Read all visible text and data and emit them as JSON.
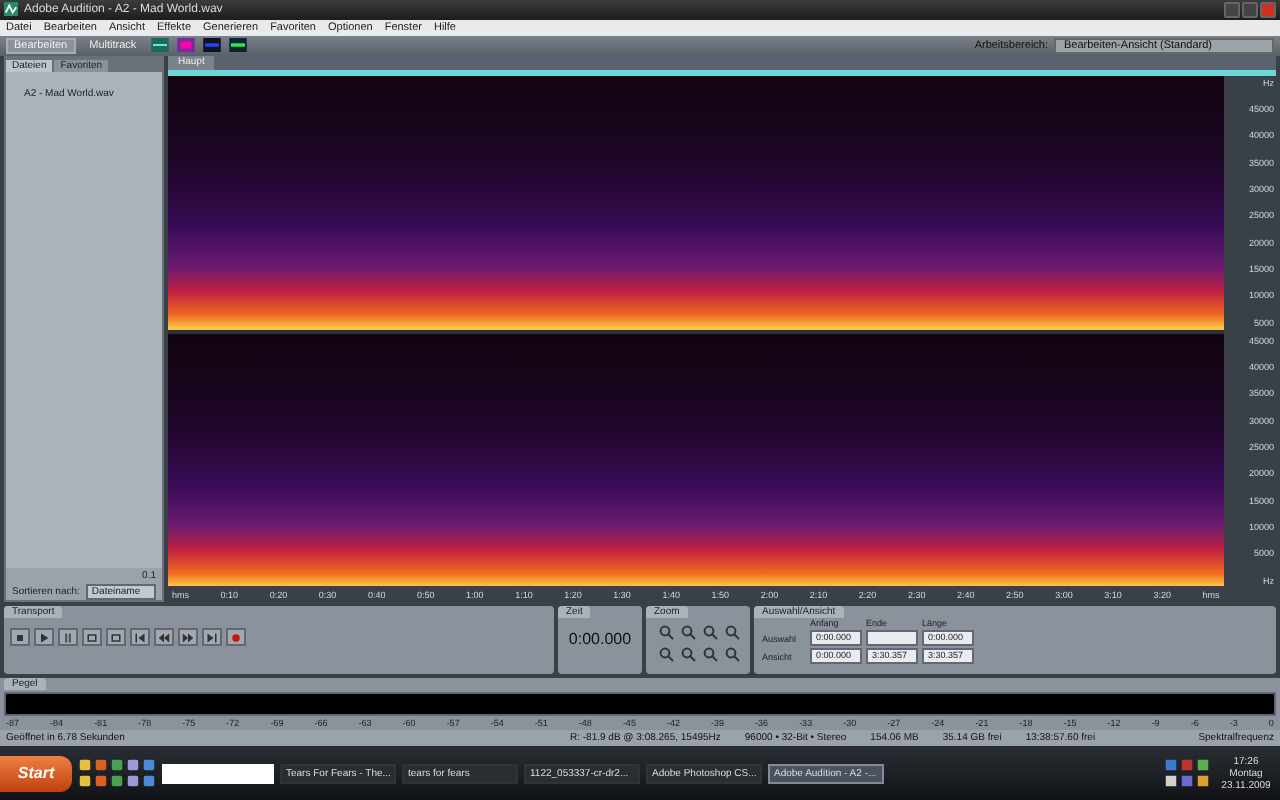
{
  "window": {
    "title": "Adobe Audition - A2 - Mad World.wav"
  },
  "menu": [
    "Datei",
    "Bearbeiten",
    "Ansicht",
    "Effekte",
    "Generieren",
    "Favoriten",
    "Optionen",
    "Fenster",
    "Hilfe"
  ],
  "toolbar": {
    "modes": [
      {
        "label": "Bearbeiten",
        "selected": true
      },
      {
        "label": "Multitrack",
        "selected": false
      }
    ],
    "workspace_label": "Arbeitsbereich:",
    "workspace": "Bearbeiten-Ansicht (Standard)"
  },
  "files_panel": {
    "tabs": [
      {
        "label": "Dateien",
        "selected": true
      },
      {
        "label": "Favoriten",
        "selected": false
      }
    ],
    "files": [
      "A2 - Mad World.wav"
    ],
    "volume": "0.1",
    "sort_label": "Sortieren nach:",
    "sort_value": "Dateiname"
  },
  "editor": {
    "tab": "Haupt",
    "channels": [
      {
        "labels": [
          "Hz",
          "45000",
          "40000",
          "35000",
          "30000",
          "25000",
          "20000",
          "15000",
          "10000",
          "5000"
        ]
      },
      {
        "labels": [
          "45000",
          "40000",
          "35000",
          "30000",
          "25000",
          "20000",
          "15000",
          "10000",
          "5000",
          "Hz"
        ]
      }
    ],
    "time_labels": [
      "hms",
      "0:10",
      "0:20",
      "0:30",
      "0:40",
      "0:50",
      "1:00",
      "1:10",
      "1:20",
      "1:30",
      "1:40",
      "1:50",
      "2:00",
      "2:10",
      "2:20",
      "2:30",
      "2:40",
      "2:50",
      "3:00",
      "3:10",
      "3:20",
      "hms"
    ]
  },
  "transport": {
    "title": "Transport"
  },
  "time": {
    "title": "Zeit",
    "value": "0:00.000"
  },
  "zoom": {
    "title": "Zoom"
  },
  "selection": {
    "title": "Auswahl/Ansicht",
    "columns": [
      "Anfang",
      "Ende",
      "Länge"
    ],
    "rows": [
      {
        "label": "Auswahl",
        "start": "0:00.000",
        "length": "0:00.000"
      },
      {
        "label": "Ansicht",
        "start": "0:00.000",
        "end": "3:30.357",
        "length": "3:30.357"
      }
    ]
  },
  "meter": {
    "title": "Pegel",
    "scale": [
      "-87",
      "-84",
      "-81",
      "-78",
      "-75",
      "-72",
      "-69",
      "-66",
      "-63",
      "-60",
      "-57",
      "-54",
      "-51",
      "-48",
      "-45",
      "-42",
      "-39",
      "-36",
      "-33",
      "-30",
      "-27",
      "-24",
      "-21",
      "-18",
      "-15",
      "-12",
      "-9",
      "-6",
      "-3",
      "0"
    ]
  },
  "status_bar": [
    "Geöffnet in 6.78 Sekunden",
    "R: -81.9 dB @ 3:08.265, 15495Hz",
    "96000 • 32-Bit • Stereo",
    "154.06 MB",
    "35.14 GB frei",
    "13:38:57.60 frei",
    "Spektralfrequenz"
  ],
  "taskbar": {
    "start": "Start",
    "tasks": [
      {
        "label": "Tears For Fears - The...",
        "selected": false
      },
      {
        "label": "tears for fears",
        "selected": false
      },
      {
        "label": "1122_053337-cr-dr2...",
        "selected": false
      },
      {
        "label": "Adobe Photoshop CS...",
        "selected": false
      },
      {
        "label": "Adobe Audition - A2 -...",
        "selected": true
      }
    ],
    "clock": {
      "time": "17:26",
      "day": "Montag",
      "date": "23.11.2009"
    }
  }
}
